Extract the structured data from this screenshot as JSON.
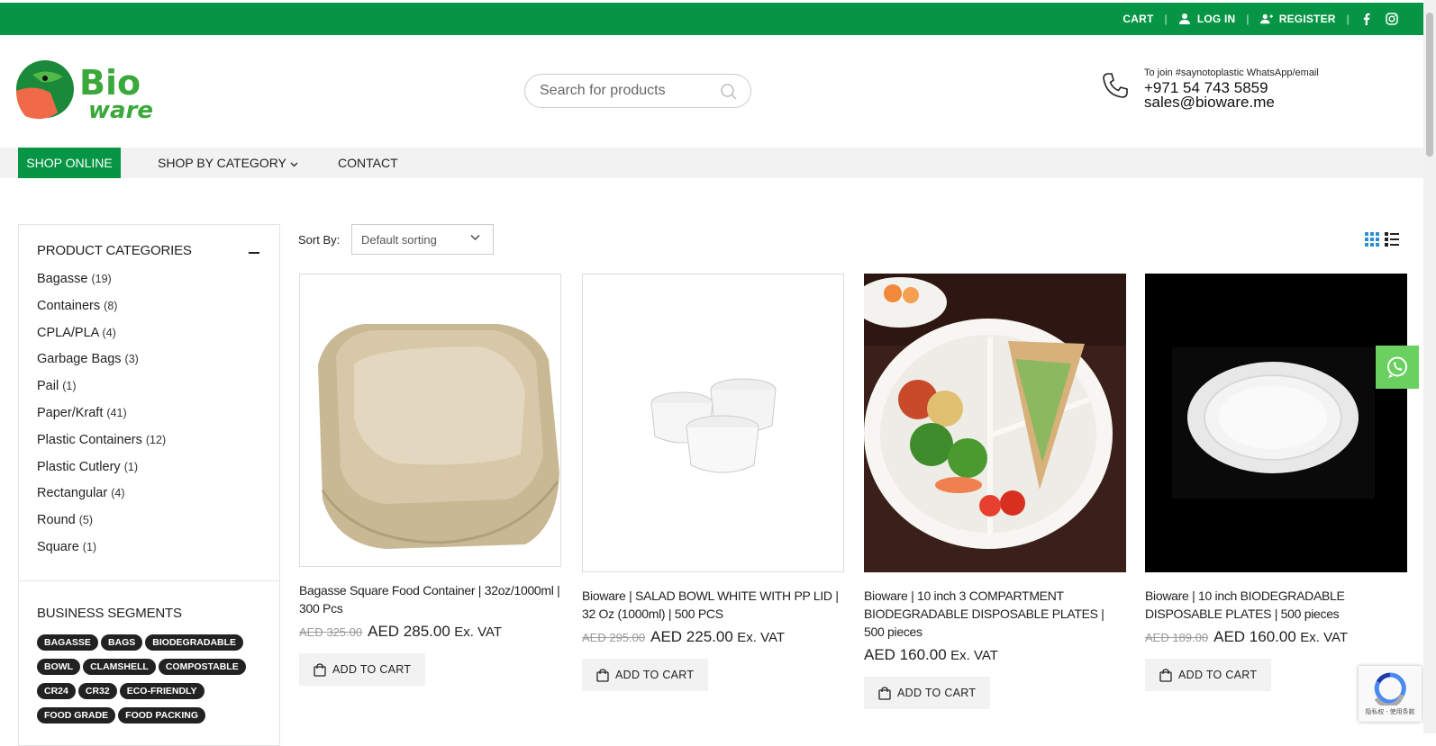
{
  "topbar": {
    "cart": "CART",
    "login": "LOG IN",
    "register": "REGISTER",
    "sep": "|"
  },
  "header": {
    "search_placeholder": "Search for products",
    "contact_note": "To join #saynotoplastic WhatsApp/email",
    "phone": "+971 54 743 5859",
    "email": "sales@bioware.me"
  },
  "nav": {
    "items": [
      "SHOP ONLINE",
      "SHOP BY CATEGORY",
      "CONTACT"
    ]
  },
  "sidebar": {
    "categories_title": "PRODUCT CATEGORIES",
    "categories": [
      {
        "name": "Bagasse",
        "count": "(19)"
      },
      {
        "name": "Containers",
        "count": "(8)"
      },
      {
        "name": "CPLA/PLA",
        "count": "(4)"
      },
      {
        "name": "Garbage Bags",
        "count": "(3)"
      },
      {
        "name": "Pail",
        "count": "(1)"
      },
      {
        "name": "Paper/Kraft",
        "count": "(41)"
      },
      {
        "name": "Plastic Containers",
        "count": "(12)"
      },
      {
        "name": "Plastic Cutlery",
        "count": "(1)"
      },
      {
        "name": "Rectangular",
        "count": "(4)"
      },
      {
        "name": "Round",
        "count": "(5)"
      },
      {
        "name": "Square",
        "count": "(1)"
      }
    ],
    "segments_title": "BUSINESS SEGMENTS",
    "tags": [
      "BAGASSE",
      "BAGS",
      "BIODEGRADABLE",
      "BOWL",
      "CLAMSHELL",
      "COMPOSTABLE",
      "CR24",
      "CR32",
      "ECO-FRIENDLY",
      "FOOD GRADE",
      "FOOD PACKING"
    ]
  },
  "sort": {
    "label": "Sort By:",
    "value": "Default sorting"
  },
  "products": [
    {
      "title": "Bagasse Square Food Container | 32oz/1000ml | 300 Pcs",
      "old": "AED 325.00",
      "price": "AED 285.00",
      "vat": "Ex. VAT",
      "cta": "ADD TO CART"
    },
    {
      "title": "Bioware | SALAD BOWL WHITE WITH PP LID | 32 Oz (1000ml) | 500 PCS",
      "old": "AED 295.00",
      "price": "AED 225.00",
      "vat": "Ex. VAT",
      "cta": "ADD TO CART"
    },
    {
      "title": "Bioware | 10 inch 3 COMPARTMENT BIODEGRADABLE DISPOSABLE PLATES | 500 pieces",
      "old": "",
      "price": "AED 160.00",
      "vat": "Ex. VAT",
      "cta": "ADD TO CART"
    },
    {
      "title": "Bioware | 10 inch BIODEGRADABLE DISPOSABLE PLATES | 500 pieces",
      "old": "AED 189.00",
      "price": "AED 160.00",
      "vat": "Ex. VAT",
      "cta": "ADD TO CART"
    }
  ],
  "recaptcha": "隐私权 - 使用条款",
  "colors": {
    "brand_green": "#069544",
    "whatsapp_green": "#6ad05f"
  }
}
